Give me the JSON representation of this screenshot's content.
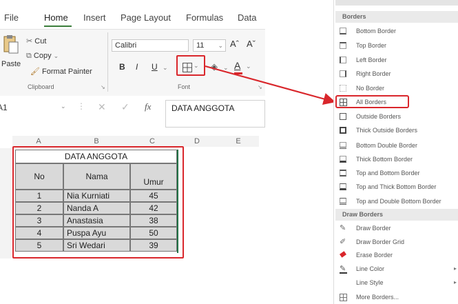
{
  "ribbon_tabs": [
    "File",
    "Home",
    "Insert",
    "Page Layout",
    "Formulas",
    "Data"
  ],
  "clipboard": {
    "paste": "Paste",
    "cut": "Cut",
    "copy": "Copy",
    "format_painter": "Format Painter",
    "group_label": "Clipboard"
  },
  "font": {
    "name": "Calibri",
    "size": "11",
    "grow": "Aˆ",
    "shrink": "Aˇ",
    "bold": "B",
    "italic": "I",
    "underline": "U",
    "font_color": "A",
    "group_label": "Font"
  },
  "formula_bar": {
    "name_box": "A1",
    "fx": "fx",
    "content": "DATA ANGGOTA"
  },
  "sheet": {
    "columns": [
      "A",
      "B",
      "C",
      "D",
      "E"
    ],
    "title": "DATA ANGGOTA",
    "headers": [
      "No",
      "Nama",
      "Umur\nAnggota"
    ],
    "rows": [
      [
        "1",
        "Nia Kurniati",
        "45"
      ],
      [
        "2",
        "Nanda A",
        "42"
      ],
      [
        "3",
        "Anastasia",
        "38"
      ],
      [
        "4",
        "Puspa Ayu",
        "50"
      ],
      [
        "5",
        "Sri Wedari",
        "39"
      ]
    ]
  },
  "borders_menu": {
    "borders_header": "Borders",
    "items": [
      "Bottom Border",
      "Top Border",
      "Left Border",
      "Right Border",
      "No Border",
      "All Borders",
      "Outside Borders",
      "Thick Outside Borders",
      "Bottom Double Border",
      "Thick Bottom Border",
      "Top and Bottom Border",
      "Top and Thick Bottom Border",
      "Top and Double Bottom Border"
    ],
    "draw_header": "Draw Borders",
    "draw_items": [
      "Draw Border",
      "Draw Border Grid",
      "Erase Border",
      "Line Color",
      "Line Style",
      "More Borders..."
    ]
  },
  "colors": {
    "highlight": "#d9262b",
    "ribbon_accent": "#3a7d3a",
    "table_shade": "#d9d9d9"
  }
}
